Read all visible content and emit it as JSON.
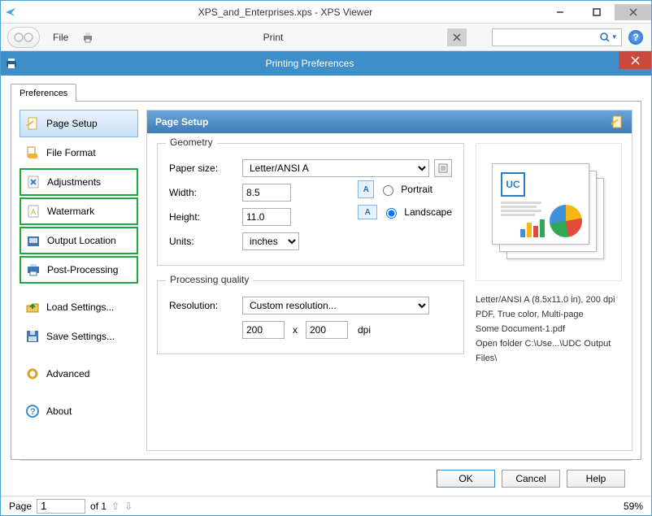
{
  "window": {
    "title": "XPS_and_Enterprises.xps - XPS Viewer"
  },
  "toolbar": {
    "file": "File",
    "print": "Print"
  },
  "dialog": {
    "title": "Printing Preferences",
    "tab": "Preferences",
    "sidebar": {
      "page_setup": "Page Setup",
      "file_format": "File Format",
      "adjustments": "Adjustments",
      "watermark": "Watermark",
      "output_location": "Output Location",
      "post_processing": "Post-Processing",
      "load_settings": "Load Settings...",
      "save_settings": "Save Settings...",
      "advanced": "Advanced",
      "about": "About"
    },
    "panel": {
      "title": "Page Setup",
      "geometry": {
        "legend": "Geometry",
        "paper_size_label": "Paper size:",
        "paper_size_value": "Letter/ANSI A",
        "width_label": "Width:",
        "width_value": "8.5",
        "height_label": "Height:",
        "height_value": "11.0",
        "units_label": "Units:",
        "units_value": "inches",
        "portrait": "Portrait",
        "landscape": "Landscape",
        "orientation": "landscape"
      },
      "quality": {
        "legend": "Processing quality",
        "resolution_label": "Resolution:",
        "resolution_value": "Custom resolution...",
        "dpi_x": "200",
        "dpi_y": "200",
        "dpi_mult": "x",
        "dpi_suffix": "dpi"
      },
      "info": {
        "l1": "Letter/ANSI A (8.5x11.0 in), 200 dpi",
        "l2": "PDF, True color, Multi-page",
        "l3": "Some Document-1.pdf",
        "l4": "Open folder C:\\Use...\\UDC Output Files\\"
      }
    },
    "buttons": {
      "ok": "OK",
      "cancel": "Cancel",
      "help": "Help"
    }
  },
  "status": {
    "page_label": "Page",
    "page_value": "1",
    "page_total": "of 1",
    "zoom": "59%"
  }
}
